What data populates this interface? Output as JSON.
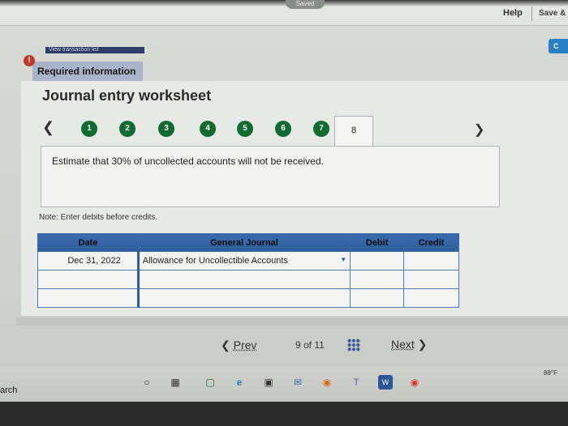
{
  "topbar": {
    "saved_label": "Saved",
    "help_label": "Help",
    "save_label": "Save &",
    "c_label": "C"
  },
  "view_transaction_list": "View transaction list",
  "required_info": "Required information",
  "worksheet": {
    "title": "Journal entry worksheet",
    "steps": [
      "1",
      "2",
      "3",
      "4",
      "5",
      "6",
      "7",
      "8"
    ],
    "active_step": "8",
    "instruction": "Estimate that 30% of uncollected accounts will not be received.",
    "note": "Note: Enter debits before credits."
  },
  "table": {
    "headers": {
      "date": "Date",
      "general_journal": "General Journal",
      "debit": "Debit",
      "credit": "Credit"
    },
    "rows": [
      {
        "date": "Dec 31, 2022",
        "account": "Allowance for Uncollectible Accounts",
        "debit": "",
        "credit": ""
      },
      {
        "date": "",
        "account": "",
        "debit": "",
        "credit": ""
      },
      {
        "date": "",
        "account": "",
        "debit": "",
        "credit": ""
      }
    ]
  },
  "pagination": {
    "prev_label": "Prev",
    "page_label": "9 of 11",
    "next_label": "Next"
  },
  "taskbar": {
    "search_text": "arch",
    "temperature": "88°F"
  },
  "colors": {
    "table_header": "#2f5f9c",
    "step_done": "#0f6b2f",
    "alert": "#c0392b"
  }
}
